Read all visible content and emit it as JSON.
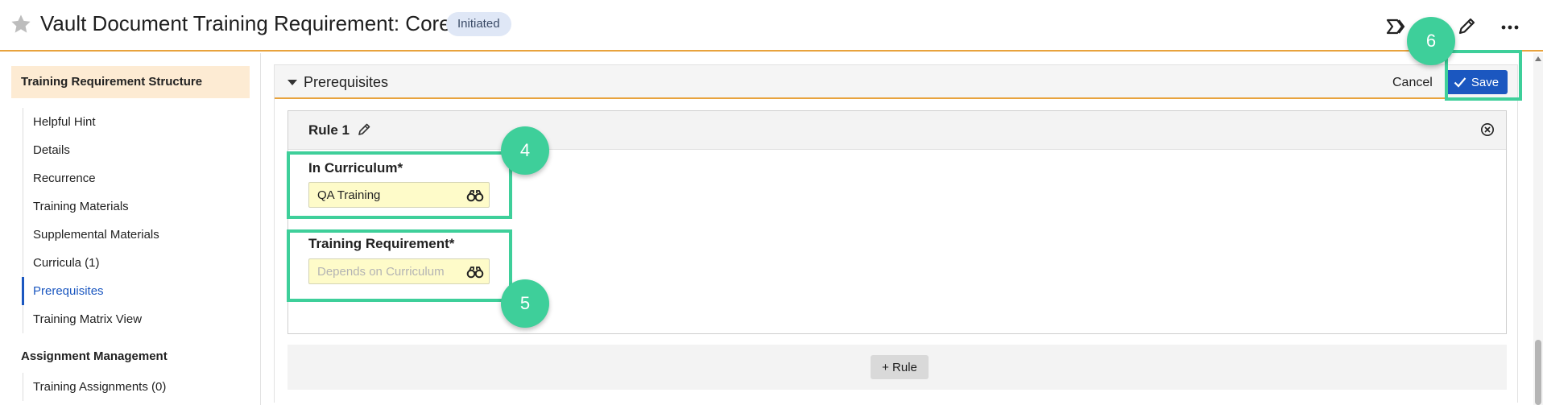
{
  "header": {
    "title": "Vault Document Training Requirement: Core",
    "status_badge": "Initiated",
    "icons": [
      "star-icon",
      "workflow-icon",
      "edit-pencil-icon",
      "more-actions-icon"
    ]
  },
  "sidebar": {
    "section_title": "Training Requirement Structure",
    "items": [
      {
        "label": "Helpful Hint"
      },
      {
        "label": "Details"
      },
      {
        "label": "Recurrence"
      },
      {
        "label": "Training Materials"
      },
      {
        "label": "Supplemental Materials"
      },
      {
        "label": "Curricula (1)"
      },
      {
        "label": "Prerequisites",
        "active": true
      },
      {
        "label": "Training Matrix View"
      }
    ],
    "section2_title": "Assignment Management",
    "items2": [
      {
        "label": "Training Assignments (0)"
      }
    ]
  },
  "main": {
    "section_title": "Prerequisites",
    "cancel_label": "Cancel",
    "save_label": "Save",
    "rule": {
      "title": "Rule 1",
      "fields": [
        {
          "label": "In Curriculum*",
          "value": "QA Training",
          "placeholder": ""
        },
        {
          "label": "Training Requirement*",
          "value": "",
          "placeholder": "Depends on Curriculum"
        }
      ]
    },
    "add_rule_label": "+ Rule"
  },
  "annotations": {
    "callout_4": "4",
    "callout_5": "5",
    "callout_6": "6",
    "color": "#3ecf9a"
  },
  "colors": {
    "accent_orange": "#e8a33d",
    "primary_blue": "#1b57c0",
    "lookup_yellow": "#fefbc9"
  }
}
